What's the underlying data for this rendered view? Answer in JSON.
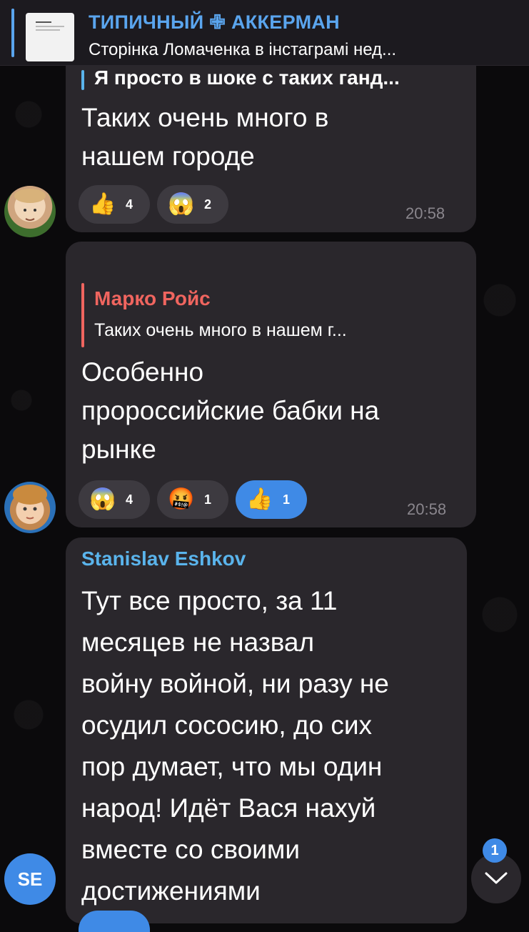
{
  "pinned": {
    "title": "ТИПИЧНЫЙ ✙ АККЕРМАН",
    "text": "Сторінка Ломаченка в інстаграмі нед..."
  },
  "messages": [
    {
      "reply_text": "Я просто в шоке с таких ганд...",
      "text_lines": [
        "Таких очень много в",
        "нашем городе"
      ],
      "reactions": [
        {
          "emoji": "👍",
          "count": "4",
          "active": false
        },
        {
          "emoji": "😱",
          "count": "2",
          "active": false
        }
      ],
      "time": "20:58"
    },
    {
      "reply_name": "Марко Ройс",
      "reply_text": "Таких очень много в нашем г...",
      "text_lines": [
        "Особенно",
        "пророссийские бабки на",
        "рынке"
      ],
      "reactions": [
        {
          "emoji": "😱",
          "count": "4",
          "active": false
        },
        {
          "emoji": "🤬",
          "count": "1",
          "active": false
        },
        {
          "emoji": "👍",
          "count": "1",
          "active": true
        }
      ],
      "time": "20:58"
    },
    {
      "sender": "Stanislav Eshkov",
      "text_lines": [
        "Тут все просто, за 11",
        "месяцев не назвал",
        "войну войной, ни разу не",
        "осудил сососию, до сих",
        "пор думает, что мы один",
        "народ! Идёт Вася нахуй",
        "вместе со своими",
        "достижениями"
      ],
      "avatar_initials": "SE"
    }
  ],
  "scroll": {
    "unread_count": "1"
  },
  "colors": {
    "accent": "#5aa5ee",
    "reply_red": "#f0655f",
    "sender_blue": "#5ab4ec",
    "bubble": "#2a272c",
    "reaction_active": "#3f8ae6",
    "avatar_se": "#3f8ae6"
  }
}
